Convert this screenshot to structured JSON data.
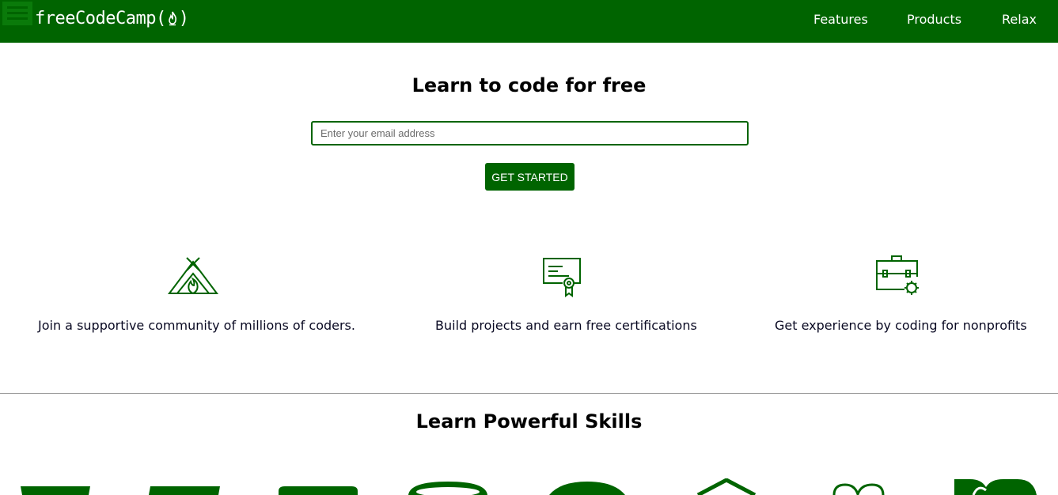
{
  "header": {
    "logo_text": "freeCodeCamp(",
    "logo_close": ")",
    "nav": [
      "Features",
      "Products",
      "Relax"
    ]
  },
  "hero": {
    "title": "Learn to code for free",
    "email_placeholder": "Enter your email address",
    "cta_label": "GET STARTED"
  },
  "features": [
    {
      "icon": "campfire-tent-icon",
      "text": "Join a supportive community of millions of coders."
    },
    {
      "icon": "certificate-icon",
      "text": "Build projects and earn free certifications"
    },
    {
      "icon": "briefcase-icon",
      "text": "Get experience by coding for nonprofits"
    }
  ],
  "skills": {
    "title": "Learn Powerful Skills",
    "icons": [
      "html5-icon",
      "css3-icon",
      "javascript-icon",
      "jquery-icon",
      "bootstrap-icon",
      "sass-icon",
      "react-icon"
    ]
  },
  "colors": {
    "brand_green": "#006400",
    "text_dark": "#0a0a23"
  }
}
